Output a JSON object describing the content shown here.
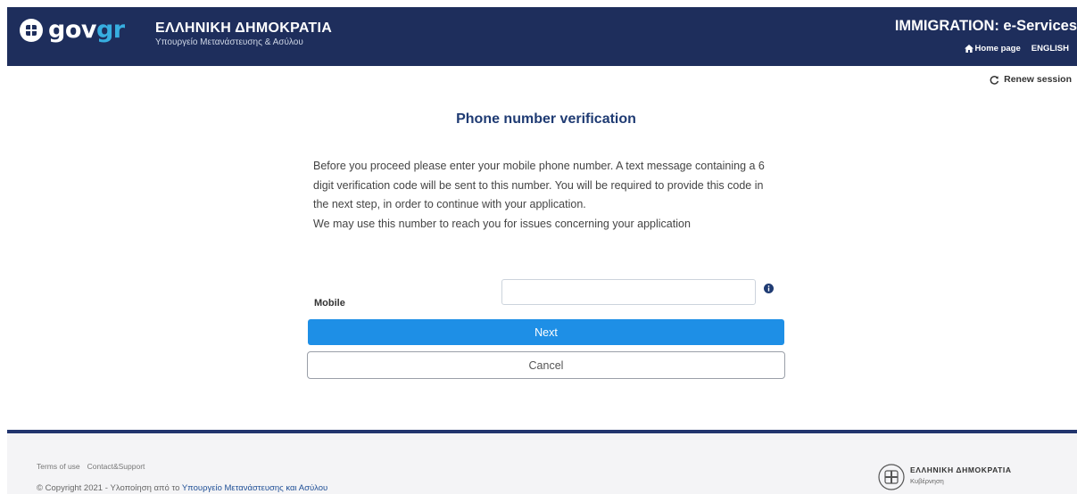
{
  "header": {
    "gov_logo_main": "gov",
    "gov_logo_accent": "gr",
    "org_title": "ΕΛΛΗΝΙΚΗ ΔΗΜΟΚΡΑΤΙΑ",
    "org_subtitle": "Υπουργείο Μετανάστευσης & Ασύλου",
    "service_title": "IMMIGRATION: e-Services",
    "home_link": "Home page",
    "language_link": "ENGLISH"
  },
  "session": {
    "renew_label": "Renew session"
  },
  "main": {
    "title": "Phone number verification",
    "intro_paragraph": "Before you proceed please enter your mobile phone number. A text message containing a 6 digit verification code will be sent to this number. You will be required to provide this code in the next step, in order to continue with your application.",
    "intro_note": "We may use this number to reach you for issues concerning your application",
    "mobile_label": "Mobile",
    "mobile_value": "",
    "next_button": "Next",
    "cancel_button": "Cancel"
  },
  "footer": {
    "terms_link": "Terms of use",
    "support_link": "Contact&Support",
    "copyright_prefix": "© Copyright 2021 - Υλοποίηση από το ",
    "copyright_link": "Υπουργείο Μετανάστευσης και Ασύλου",
    "org_title": "ΕΛΛΗΝΙΚΗ ΔΗΜΟΚΡΑΤΙΑ",
    "org_subtitle": "Κυβέρνηση"
  },
  "colors": {
    "header_bg": "#1e2e5c",
    "gov_accent": "#37aee0",
    "title_color": "#1f3b73",
    "primary_button": "#1e8fe6",
    "footer_border": "#22356e",
    "footer_link": "#1f4f96"
  },
  "icons": {
    "gov_emblem": "coat-of-arms-icon",
    "home": "home-icon",
    "renew": "refresh-icon",
    "info": "info-icon",
    "footer_emblem": "coat-of-arms-icon"
  }
}
